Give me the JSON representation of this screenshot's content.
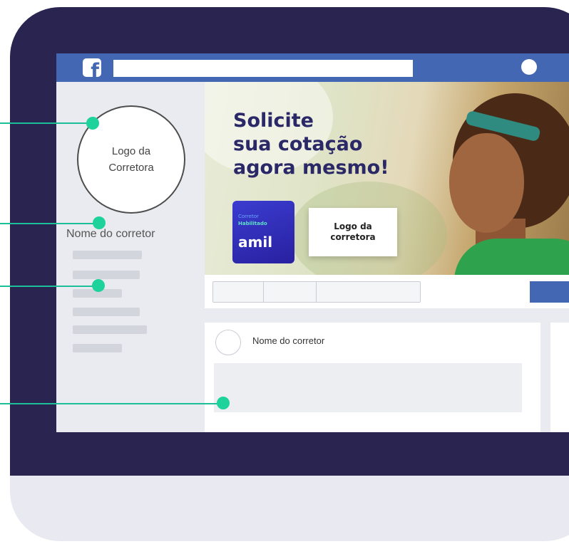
{
  "sidebar": {
    "logo_placeholder": "Logo da\nCorretora",
    "broker_name": "Nome do corretor"
  },
  "cover": {
    "headline": "Solicite\nsua cotação\nagora mesmo!",
    "badge_small_1": "Corretor",
    "badge_small_2": "Habilitado",
    "badge_brand": "amil",
    "logo_box": "Logo da\ncorretora"
  },
  "post": {
    "author": "Nome do corretor"
  },
  "colors": {
    "bezel": "#2a2550",
    "facebook_blue": "#4467b3",
    "callout_green": "#1ed29c"
  }
}
